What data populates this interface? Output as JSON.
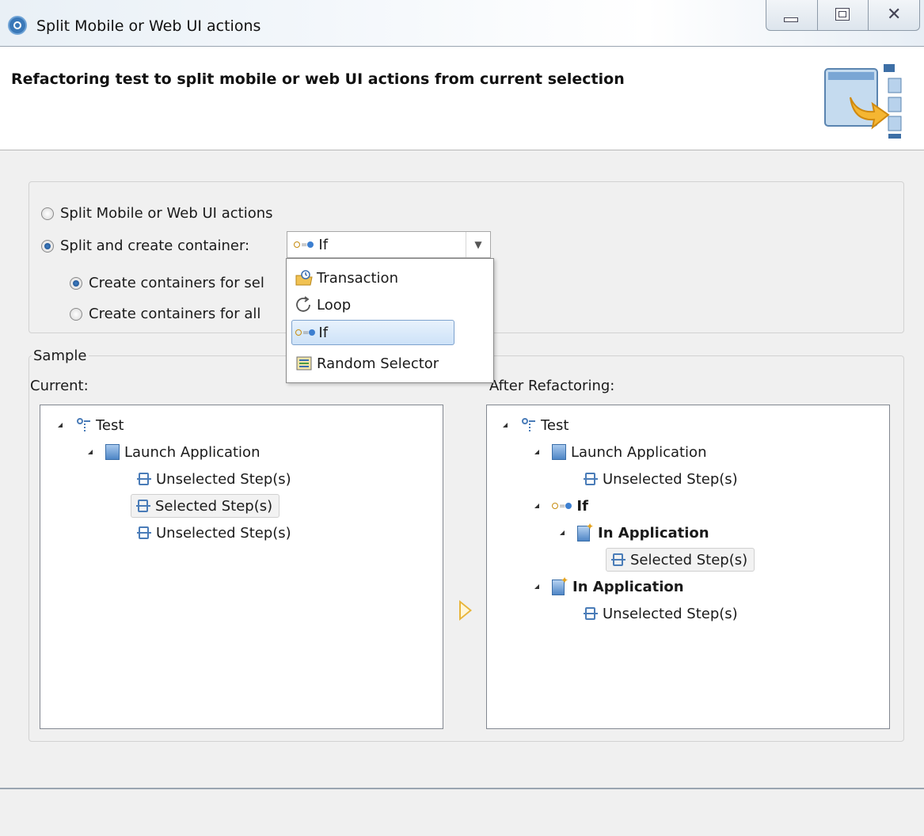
{
  "window": {
    "title": "Split Mobile or Web UI actions"
  },
  "header": {
    "title": "Refactoring test to split mobile or web UI actions from current selection"
  },
  "options": {
    "split_actions_label": "Split Mobile or Web UI actions",
    "split_and_create_label": "Split and create container:",
    "create_for_selected_label": "Create containers for sel",
    "create_for_all_label": "Create containers for all",
    "selected_option": "split_and_create",
    "selected_sub_option": "create_for_selected"
  },
  "container_combo": {
    "value": "If",
    "items": [
      {
        "label": "Transaction",
        "icon": "transaction-icon"
      },
      {
        "label": "Loop",
        "icon": "loop-icon"
      },
      {
        "label": "If",
        "icon": "if-icon"
      },
      {
        "label": "Random Selector",
        "icon": "random-selector-icon"
      }
    ],
    "highlighted": "If"
  },
  "sample": {
    "group_label": "Sample",
    "current_label": "Current:",
    "after_label": "After Refactoring:",
    "current_tree": [
      {
        "label": "Test",
        "icon": "test-icon",
        "expanded": true
      },
      {
        "label": "Launch Application",
        "icon": "application-icon",
        "expanded": true
      },
      {
        "label": "Unselected Step(s)",
        "icon": "step-icon"
      },
      {
        "label": "Selected Step(s)",
        "icon": "step-icon",
        "selected": true
      },
      {
        "label": "Unselected Step(s)",
        "icon": "step-icon"
      }
    ],
    "after_tree": [
      {
        "label": "Test",
        "icon": "test-icon",
        "expanded": true
      },
      {
        "label": "Launch Application",
        "icon": "application-icon",
        "expanded": true
      },
      {
        "label": "Unselected Step(s)",
        "icon": "step-icon"
      },
      {
        "label": "If",
        "icon": "if-icon",
        "bold": true,
        "expanded": true
      },
      {
        "label": "In Application",
        "icon": "new-application-icon",
        "bold": true,
        "expanded": true
      },
      {
        "label": "Selected Step(s)",
        "icon": "step-icon",
        "selected": true
      },
      {
        "label": "In Application",
        "icon": "new-application-icon",
        "bold": true,
        "expanded": true
      },
      {
        "label": "Unselected Step(s)",
        "icon": "step-icon"
      }
    ]
  },
  "colors": {
    "accent": "#3d7fd0",
    "selection_bg": "#cde2f8",
    "arrow": "#e8b53a"
  }
}
